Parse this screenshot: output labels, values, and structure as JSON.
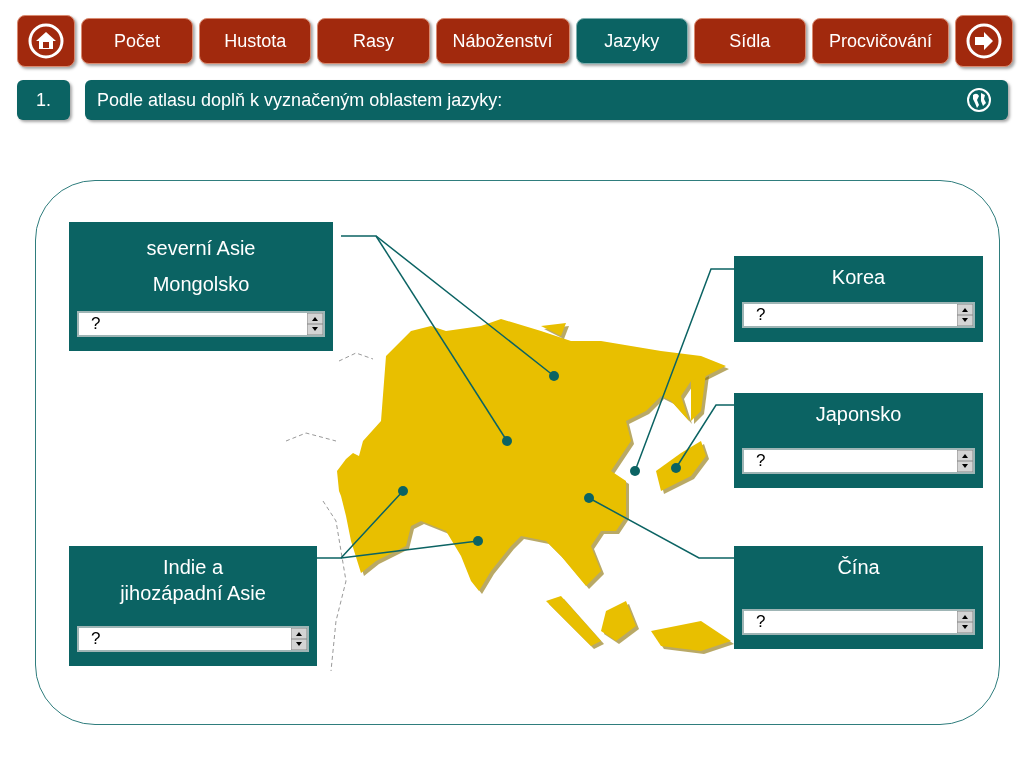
{
  "nav": {
    "tabs": [
      {
        "label": "Počet",
        "selected": false
      },
      {
        "label": "Hustota",
        "selected": false
      },
      {
        "label": "Rasy",
        "selected": false
      },
      {
        "label": "Náboženství",
        "selected": false
      },
      {
        "label": "Jazyky",
        "selected": true
      },
      {
        "label": "Sídla",
        "selected": false
      },
      {
        "label": "Procvičování",
        "selected": false
      }
    ]
  },
  "task": {
    "number": "1.",
    "instruction": "Podle atlasu doplň k vyznačeným oblastem jazyky:"
  },
  "regions": [
    {
      "lines": [
        "severní Asie",
        "Mongolsko"
      ],
      "value": "?"
    },
    {
      "lines": [
        "Korea"
      ],
      "value": "?"
    },
    {
      "lines": [
        "Japonsko"
      ],
      "value": "?"
    },
    {
      "lines": [
        "Indie a",
        "jihozápadní Asie"
      ],
      "value": "?"
    },
    {
      "lines": [
        "Čína"
      ],
      "value": "?"
    }
  ]
}
